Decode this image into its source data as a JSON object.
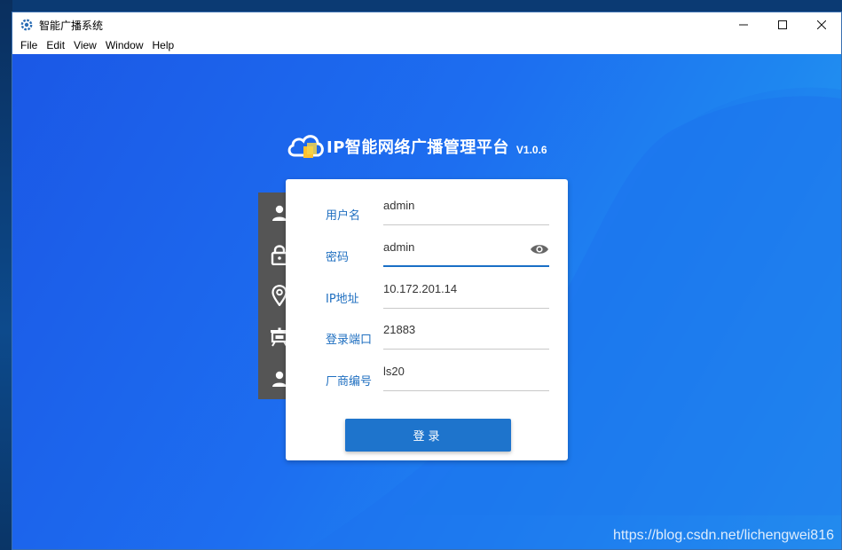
{
  "window": {
    "title": "智能广播系统"
  },
  "menu": [
    "File",
    "Edit",
    "View",
    "Window",
    "Help"
  ],
  "brand": {
    "title": "IP智能网络广播管理平台",
    "version": "V1.0.6"
  },
  "form": {
    "fields": [
      {
        "label": "用户名",
        "value": "admin",
        "icon": "user-icon"
      },
      {
        "label": "密码",
        "value": "admin",
        "icon": "lock-icon",
        "trailing_icon": "eye-icon"
      },
      {
        "label": "IP地址",
        "value": "10.172.201.14",
        "icon": "location-pin-icon"
      },
      {
        "label": "登录端口",
        "value": "21883",
        "icon": "easel-icon"
      },
      {
        "label": "厂商编号",
        "value": "ls20",
        "icon": "user-icon"
      }
    ],
    "submit_label": "登录"
  },
  "watermark": "https://blog.csdn.net/lichengwei816",
  "colors": {
    "accent": "#1e74cc",
    "label": "#1f6fc0",
    "rail": "#555555",
    "background_start": "#1b58e6",
    "background_end": "#2aa8ee"
  }
}
